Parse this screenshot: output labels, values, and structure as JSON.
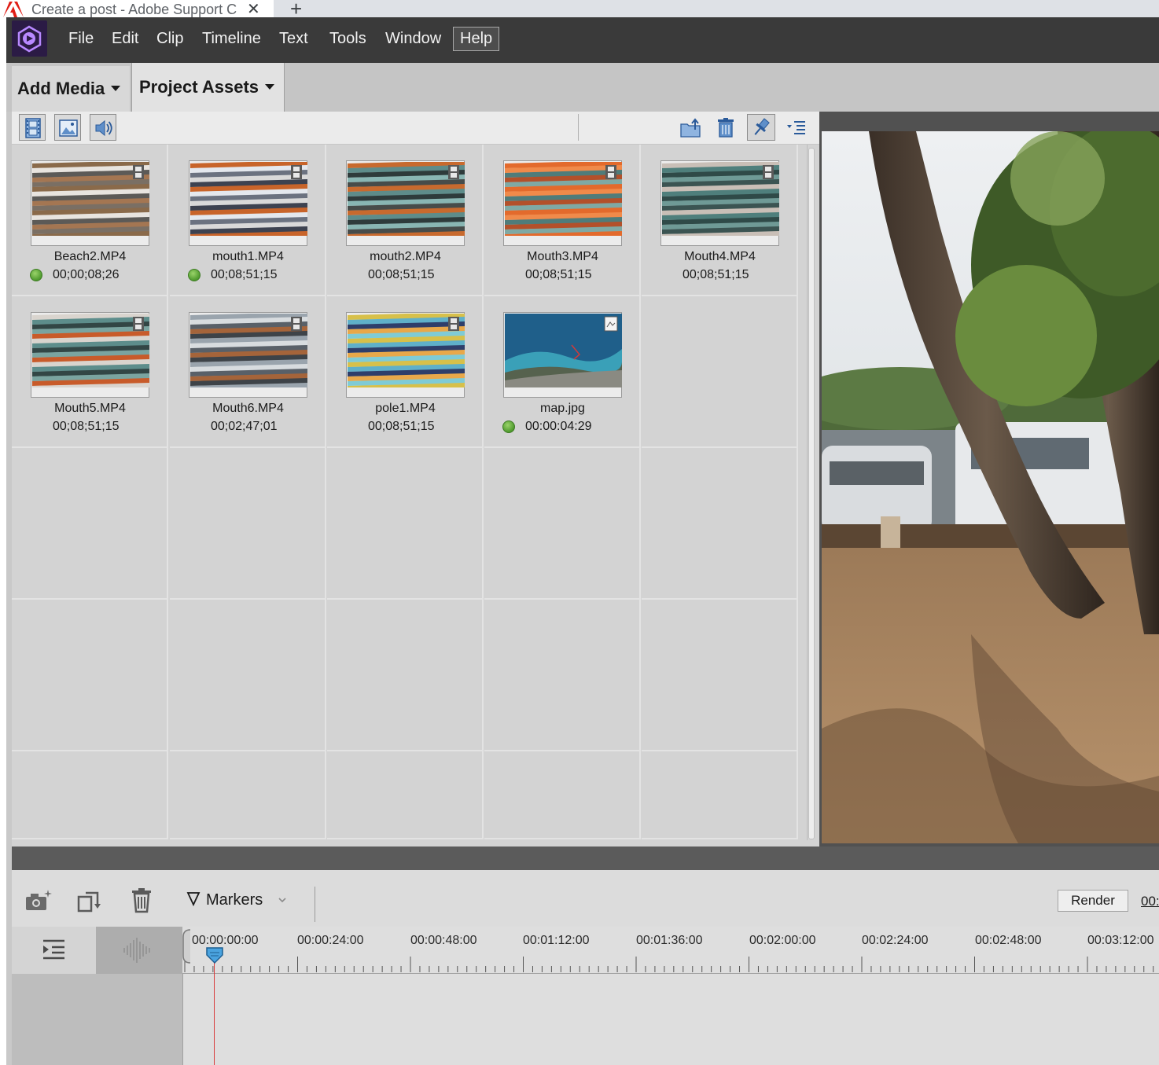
{
  "browser": {
    "tab_title": "Create a post - Adobe Support C",
    "close_glyph": "✕",
    "new_tab_glyph": "+"
  },
  "menu": {
    "items": [
      "File",
      "Edit",
      "Clip",
      "Timeline",
      "Text",
      "Tools",
      "Window",
      "Help"
    ]
  },
  "tabs": {
    "add_media": "Add Media",
    "project_assets": "Project Assets"
  },
  "assets": [
    {
      "name": "Beach2.MP4",
      "duration": "00;00;08;26",
      "used": true,
      "type": "video",
      "palette": [
        "#8a6a4a",
        "#e8e4df",
        "#5c5a57",
        "#a47652",
        "#7a6f64"
      ]
    },
    {
      "name": "mouth1.MP4",
      "duration": "00;08;51;15",
      "used": true,
      "type": "video",
      "palette": [
        "#c8642a",
        "#e4e8ee",
        "#6b7280",
        "#d9d9d9",
        "#3d4250"
      ]
    },
    {
      "name": "mouth2.MP4",
      "duration": "00;08;51;15",
      "used": false,
      "type": "video",
      "palette": [
        "#c86a2e",
        "#5e8c8a",
        "#2e3b3b",
        "#89b6b3",
        "#474c4a"
      ]
    },
    {
      "name": "Mouth3.MP4",
      "duration": "00;08;51;15",
      "used": false,
      "type": "video",
      "palette": [
        "#e36a2c",
        "#f08a4a",
        "#4f7c7a",
        "#b3502a",
        "#7fa9a4"
      ]
    },
    {
      "name": "Mouth4.MP4",
      "duration": "00;08;51;15",
      "used": false,
      "type": "video",
      "palette": [
        "#c9bfb7",
        "#4f7f7c",
        "#2f4a48",
        "#6f9a96",
        "#3b5452"
      ]
    },
    {
      "name": "Mouth5.MP4",
      "duration": "00;08;51;15",
      "used": false,
      "type": "video",
      "palette": [
        "#d9d4ce",
        "#5d8d8b",
        "#324645",
        "#7aa4a0",
        "#c85b2a"
      ]
    },
    {
      "name": "Mouth6.MP4",
      "duration": "00;02;47;01",
      "used": false,
      "type": "video",
      "palette": [
        "#9aa4ad",
        "#d8dcdf",
        "#596068",
        "#a5643a",
        "#3e4348"
      ]
    },
    {
      "name": "pole1.MP4",
      "duration": "00;08;51;15",
      "used": false,
      "type": "video",
      "palette": [
        "#d7c04a",
        "#5fb0c9",
        "#2e3e6a",
        "#e8a84a",
        "#7fcbd6"
      ]
    },
    {
      "name": "map.jpg",
      "duration": "00:00:04:29",
      "used": true,
      "type": "image",
      "palette": [
        "#1f5f8a",
        "#3aa0b8",
        "#56624e",
        "#8a8a82",
        "#2a3440"
      ]
    }
  ],
  "timeline": {
    "markers_label": "Markers",
    "render_label": "Render",
    "current_timecode": "00:",
    "ruler_ticks": [
      "00:00:00:00",
      "00:00:24:00",
      "00:00:48:00",
      "00:01:12:00",
      "00:01:36:00",
      "00:02:00:00",
      "00:02:24:00",
      "00:02:48:00",
      "00:03:12:00"
    ]
  },
  "colors": {
    "menubar": "#3a3a3a",
    "panel": "#d3d3d3",
    "playhead": "#d83a3a",
    "used_indicator": "#4f9a2e",
    "app_logo": "#2b1b45"
  }
}
